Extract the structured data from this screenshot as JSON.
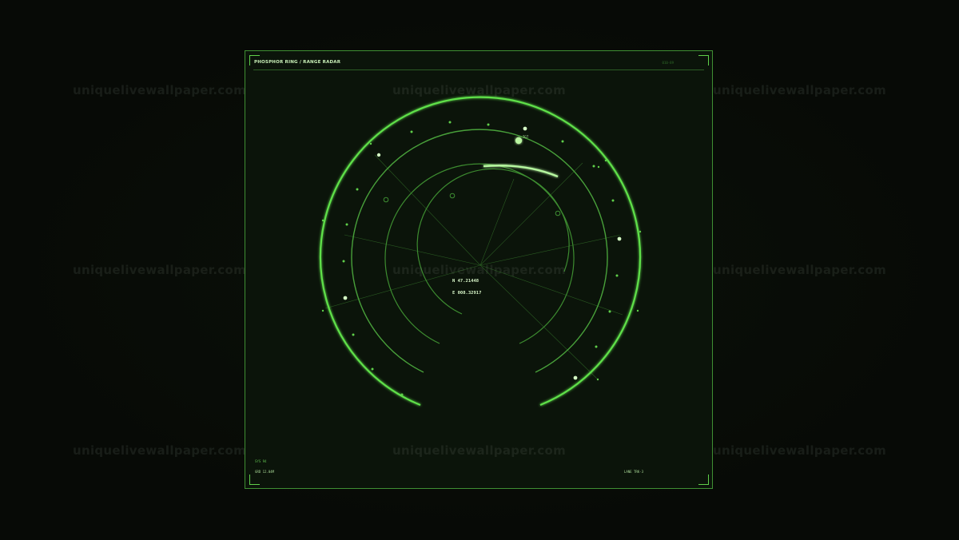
{
  "panel": {
    "title": "PHOSPHOR RING / RANGE RADAR",
    "code": "010-89"
  },
  "readout": {
    "north": "N 47.21448",
    "east": "E 008.32917"
  },
  "contact": {
    "label": "TGT"
  },
  "footer": {
    "sys": "SYS 94",
    "grid": "GRD 12.04M",
    "lane": "LANE TRK-3"
  },
  "watermark": {
    "text": "uniquelivewallpaper.com"
  },
  "colors": {
    "background": "#070b06",
    "panel": "#0b140a",
    "phosphor": "#5fe04a",
    "dim": "#2f6b28",
    "text": "#c9f0b8"
  }
}
